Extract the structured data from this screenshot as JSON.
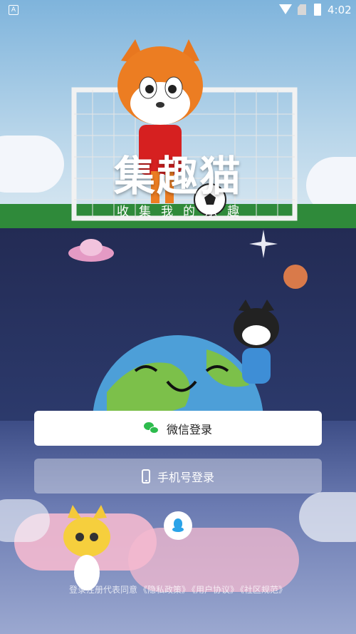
{
  "status_bar": {
    "notification_icon": "A",
    "time": "4:02"
  },
  "logo": {
    "title": "集趣猫",
    "subtitle": "收集我的乐趣"
  },
  "login": {
    "wechat_label": "微信登录",
    "phone_label": "手机号登录",
    "qq_icon": "qq-icon"
  },
  "agreement": {
    "prefix": "登录注册代表同意",
    "privacy": "《隐私政策》",
    "user": "《用户协议》",
    "community": "《社区规范》"
  },
  "colors": {
    "wechat_green": "#2dbb4d",
    "qq_blue": "#2aa3e8"
  }
}
